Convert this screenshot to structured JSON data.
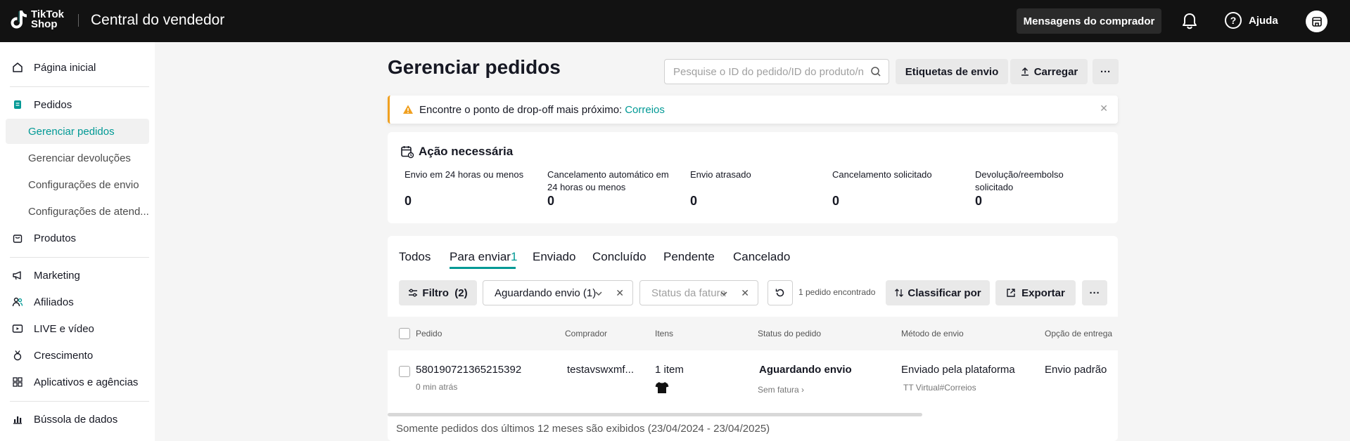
{
  "topbar": {
    "logo_line1": "TikTok",
    "logo_line2": "Shop",
    "app_title": "Central do vendedor",
    "messages_button": "Mensagens do comprador",
    "help_label": "Ajuda",
    "help_glyph": "?"
  },
  "sidebar": {
    "home": "Página inicial",
    "orders": "Pedidos",
    "manage_orders": "Gerenciar pedidos",
    "manage_returns": "Gerenciar devoluções",
    "shipping_settings": "Configurações de envio",
    "service_settings": "Configurações de atend...",
    "products": "Produtos",
    "marketing": "Marketing",
    "affiliates": "Afiliados",
    "live_video": "LIVE e vídeo",
    "growth": "Crescimento",
    "apps_agencies": "Aplicativos e agências",
    "data_compass": "Bússola de dados"
  },
  "header": {
    "title": "Gerenciar pedidos",
    "search_placeholder": "Pesquise o ID do pedido/ID do produto/nome",
    "shipping_labels_button": "Etiquetas de envio",
    "upload_button": "Carregar",
    "more_glyph": "···"
  },
  "banner": {
    "text": "Encontre o ponto de drop-off mais próximo:",
    "link": "Correios",
    "close_glyph": "✕"
  },
  "action": {
    "title": "Ação necessária",
    "metrics": [
      {
        "label": "Envio em 24 horas ou menos",
        "value": "0"
      },
      {
        "label": "Cancelamento automático em 24 horas ou menos",
        "value": "0"
      },
      {
        "label": "Envio atrasado",
        "value": "0"
      },
      {
        "label": "Cancelamento solicitado",
        "value": "0"
      },
      {
        "label": "Devolução/reembolso solicitado",
        "value": "0"
      }
    ]
  },
  "tabs": {
    "all": "Todos",
    "to_ship": "Para enviar",
    "to_ship_count": "1",
    "shipped": "Enviado",
    "completed": "Concluído",
    "pending": "Pendente",
    "cancelled": "Cancelado"
  },
  "filters": {
    "filter_button": "Filtro  (2)",
    "status_select": "Aguardando envio (1)",
    "invoice_placeholder": "Status da fatura",
    "clear_glyph": "✕",
    "found_text": "1 pedido encontrado",
    "sort_button": "Classificar por",
    "export_button": "Exportar",
    "more_glyph": "···"
  },
  "table": {
    "columns": [
      "Pedido",
      "Comprador",
      "Itens",
      "Status do pedido",
      "Método de envio",
      "Opção de entrega"
    ],
    "rows": [
      {
        "order_id": "580190721365215392",
        "time_ago": "0 min atrás",
        "buyer": "testavswxmf...",
        "items": "1 item",
        "status": "Aguardando envio",
        "invoice": "Sem fatura",
        "shipping_method": "Enviado pela plataforma",
        "carrier": "TT Virtual#Correios",
        "delivery_option": "Envio padrão"
      }
    ]
  },
  "footnote": "Somente pedidos dos últimos 12 meses são exibidos (23/04/2024 - 23/04/2025)",
  "colors": {
    "accent": "#009995",
    "topbar": "#121212",
    "warning": "#f0a020"
  }
}
